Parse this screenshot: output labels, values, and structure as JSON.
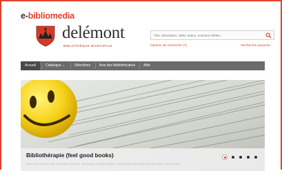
{
  "brand": {
    "part1": "e-",
    "part2": "bibliomedia"
  },
  "logo": {
    "name": "delémont",
    "subtitle": "BIBLIOTHÈQUE MUNICIPALE"
  },
  "search": {
    "placeholder": "Titre, description, ISBN, auteur, nom/mot-clé/lieu",
    "options_label": "Options de recherche (7)",
    "advanced_label": "Recherche avancée"
  },
  "nav": {
    "items": [
      {
        "label": "Accueil",
        "active": true
      },
      {
        "label": "Catalogue  ⌄",
        "active": false
      },
      {
        "label": "Sélections",
        "active": false
      },
      {
        "label": "Avis des bibliothécaires",
        "active": false
      },
      {
        "label": "Aide",
        "active": false
      }
    ]
  },
  "banner": {
    "title": "Bibliothérapie (feel good books)",
    "description": "Pour retrouver bien-être, accueillir le bonheur, développer l'énergie positive : une sélection de livres pour vous aider à mieux vivre",
    "slides_total": 5,
    "active_slide": 1
  },
  "colors": {
    "accent": "#e2402c",
    "nav_bg": "#6b6b6b",
    "nav_active": "#4a4a4a"
  },
  "icons": {
    "search": "search-icon",
    "shield": "coat-of-arms-icon"
  }
}
